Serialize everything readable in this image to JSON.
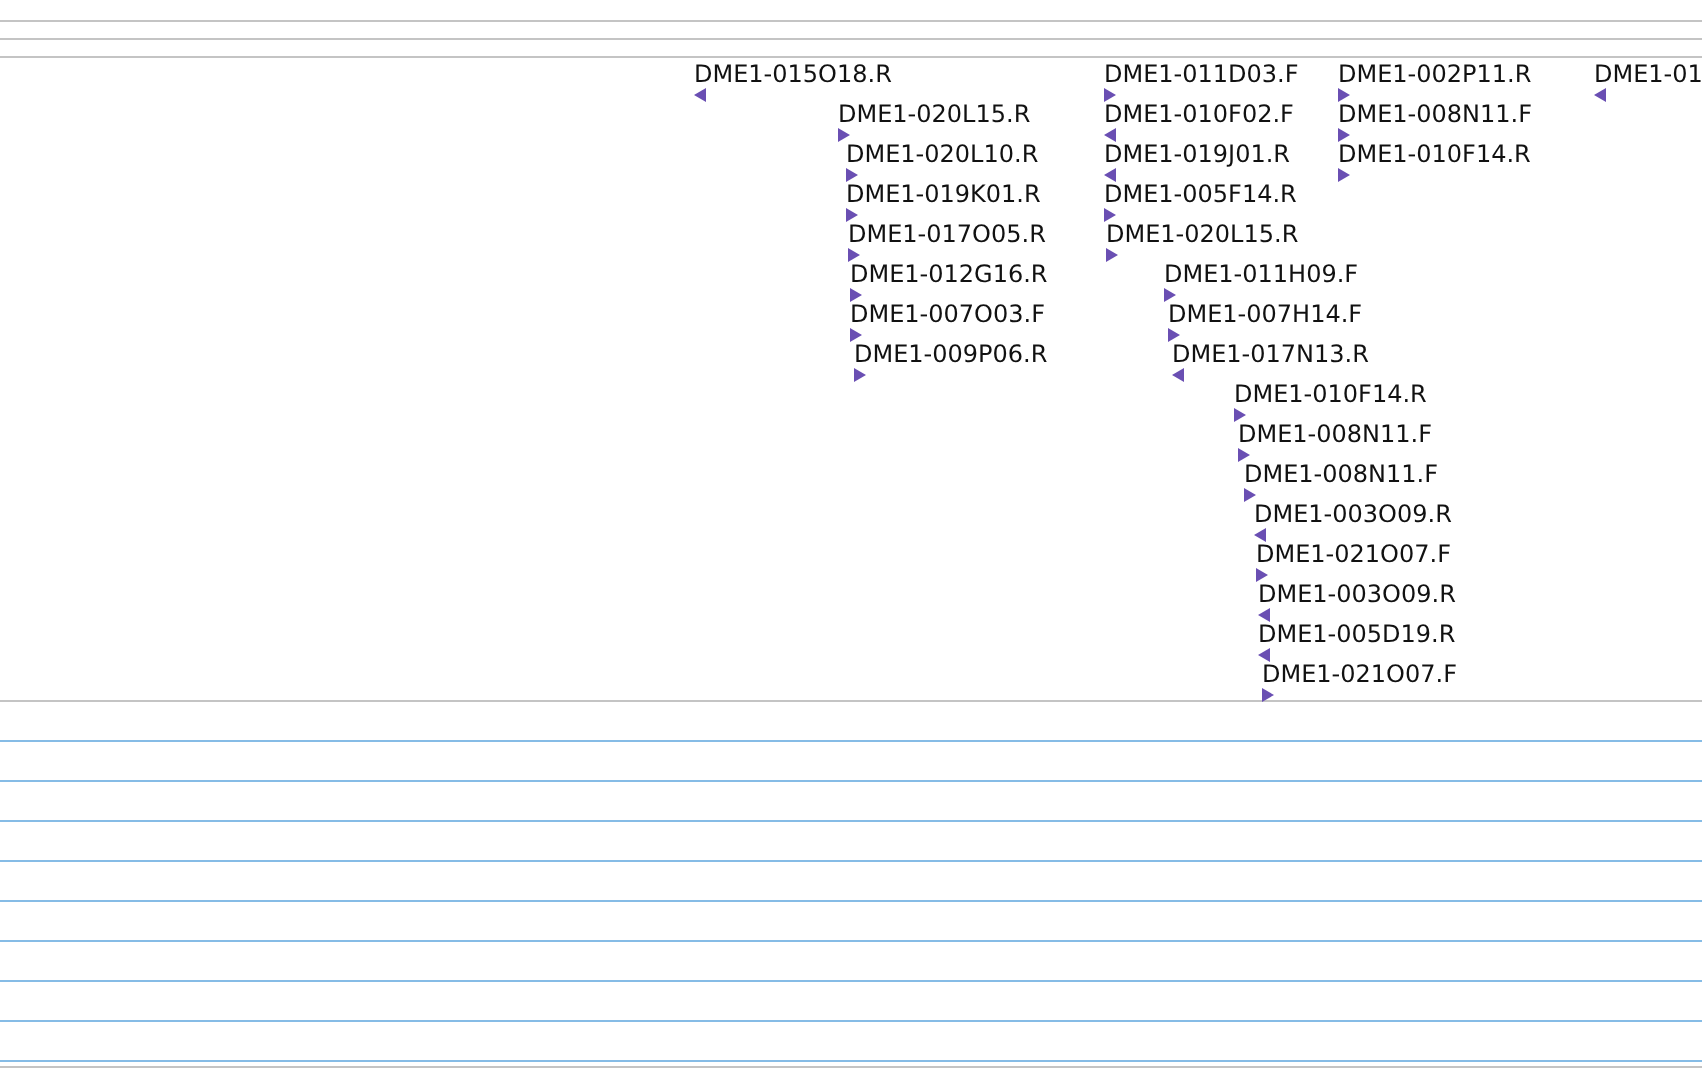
{
  "reads": [
    {
      "label": "DME1-015O18.R",
      "reverse": true
    },
    {
      "label": "DME1-020L15.R",
      "reverse": false
    },
    {
      "label": "DME1-020L10.R",
      "reverse": false
    },
    {
      "label": "DME1-019K01.R",
      "reverse": false
    },
    {
      "label": "DME1-017O05.R",
      "reverse": false
    },
    {
      "label": "DME1-012G16.R",
      "reverse": false
    },
    {
      "label": "DME1-007O03.F",
      "reverse": false
    },
    {
      "label": "DME1-009P06.R",
      "reverse": false
    },
    {
      "label": "DME1-011D03.F",
      "reverse": false
    },
    {
      "label": "DME1-010F02.F",
      "reverse": true
    },
    {
      "label": "DME1-019J01.R",
      "reverse": true
    },
    {
      "label": "DME1-005F14.R",
      "reverse": false
    },
    {
      "label": "DME1-020L15.R",
      "reverse": false
    },
    {
      "label": "DME1-011H09.F",
      "reverse": false
    },
    {
      "label": "DME1-007H14.F",
      "reverse": false
    },
    {
      "label": "DME1-017N13.R",
      "reverse": true
    },
    {
      "label": "DME1-010F14.R",
      "reverse": false
    },
    {
      "label": "DME1-008N11.F",
      "reverse": false
    },
    {
      "label": "DME1-008N11.F",
      "reverse": false
    },
    {
      "label": "DME1-003O09.R",
      "reverse": true
    },
    {
      "label": "DME1-021O07.F",
      "reverse": false
    },
    {
      "label": "DME1-003O09.R",
      "reverse": true
    },
    {
      "label": "DME1-005D19.R",
      "reverse": true
    },
    {
      "label": "DME1-021O07.F",
      "reverse": false
    },
    {
      "label": "DME1-002P11.R",
      "reverse": false
    },
    {
      "label": "DME1-008N11.F",
      "reverse": false
    },
    {
      "label": "DME1-010F14.R",
      "reverse": false
    },
    {
      "label": "DME1-01",
      "reverse": true
    }
  ]
}
